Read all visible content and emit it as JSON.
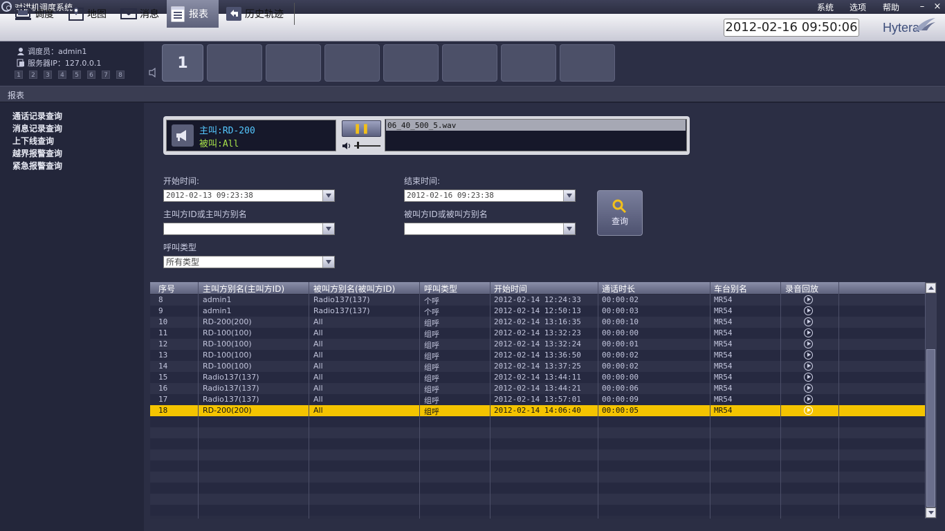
{
  "window": {
    "title": "对讲机调度系统",
    "menu": [
      "系统",
      "选项",
      "帮助"
    ],
    "controls": {
      "minimize": "–",
      "close": "×"
    }
  },
  "toolbar": {
    "tabs": [
      {
        "label": "调度",
        "icon": "dispatch-icon"
      },
      {
        "label": "地图",
        "icon": "map-icon"
      },
      {
        "label": "消息",
        "icon": "message-icon"
      },
      {
        "label": "报表",
        "icon": "report-icon",
        "active": true
      },
      {
        "label": "历史轨迹",
        "icon": "back-arrow-icon"
      }
    ],
    "clock": "2012-02-16 09:50:06",
    "logo": "Hytera"
  },
  "info": {
    "operator": "调度员：admin1",
    "server": "服务器IP：127.0.0.1",
    "keys": [
      "1",
      "2",
      "3",
      "4",
      "5",
      "6",
      "7",
      "8"
    ]
  },
  "channels": {
    "active": "1"
  },
  "section": {
    "title": "报表"
  },
  "leftmenu": [
    "通话记录查询",
    "消息记录查询",
    "上下线查询",
    "越界报警查询",
    "紧急报警查询"
  ],
  "player": {
    "caller": "主叫:RD-200",
    "callee": "被叫:All",
    "pause_glyph": "❚❚",
    "track": "06_40_500_5.wav"
  },
  "form": {
    "start_label": "开始时间:",
    "start_value": "2012-02-13 09:23:38",
    "end_label": "结束时间:",
    "end_value": "2012-02-16 09:23:38",
    "caller_label": "主叫方ID或主叫方别名",
    "caller_value": "",
    "callee_label": "被叫方ID或被叫方别名",
    "callee_value": "",
    "calltype_label": "呼叫类型",
    "calltype_value": "所有类型",
    "query_label": "查询"
  },
  "table": {
    "headers": [
      "序号",
      "主叫方别名(主叫方ID)",
      "被叫方别名(被叫方ID)",
      "呼叫类型",
      "开始时间",
      "通话时长",
      "车台别名",
      "录音回放"
    ],
    "rows": [
      [
        "8",
        "admin1",
        "Radio137(137)",
        "个呼",
        "2012-02-14 12:24:33",
        "00:00:02",
        "MR54"
      ],
      [
        "9",
        "admin1",
        "Radio137(137)",
        "个呼",
        "2012-02-14 12:50:13",
        "00:00:03",
        "MR54"
      ],
      [
        "10",
        "RD-200(200)",
        "All",
        "组呼",
        "2012-02-14 13:16:35",
        "00:00:10",
        "MR54"
      ],
      [
        "11",
        "RD-100(100)",
        "All",
        "组呼",
        "2012-02-14 13:32:23",
        "00:00:00",
        "MR54"
      ],
      [
        "12",
        "RD-100(100)",
        "All",
        "组呼",
        "2012-02-14 13:32:24",
        "00:00:01",
        "MR54"
      ],
      [
        "13",
        "RD-100(100)",
        "All",
        "组呼",
        "2012-02-14 13:36:50",
        "00:00:02",
        "MR54"
      ],
      [
        "14",
        "RD-100(100)",
        "All",
        "组呼",
        "2012-02-14 13:37:25",
        "00:00:02",
        "MR54"
      ],
      [
        "15",
        "Radio137(137)",
        "All",
        "组呼",
        "2012-02-14 13:44:11",
        "00:00:00",
        "MR54"
      ],
      [
        "16",
        "Radio137(137)",
        "All",
        "组呼",
        "2012-02-14 13:44:21",
        "00:00:06",
        "MR54"
      ],
      [
        "17",
        "Radio137(137)",
        "All",
        "组呼",
        "2012-02-14 13:57:01",
        "00:00:09",
        "MR54"
      ],
      [
        "18",
        "RD-200(200)",
        "All",
        "组呼",
        "2012-02-14 14:06:40",
        "00:00:05",
        "MR54"
      ]
    ],
    "selected_row": 10,
    "highlight_color": "#f4c400"
  }
}
